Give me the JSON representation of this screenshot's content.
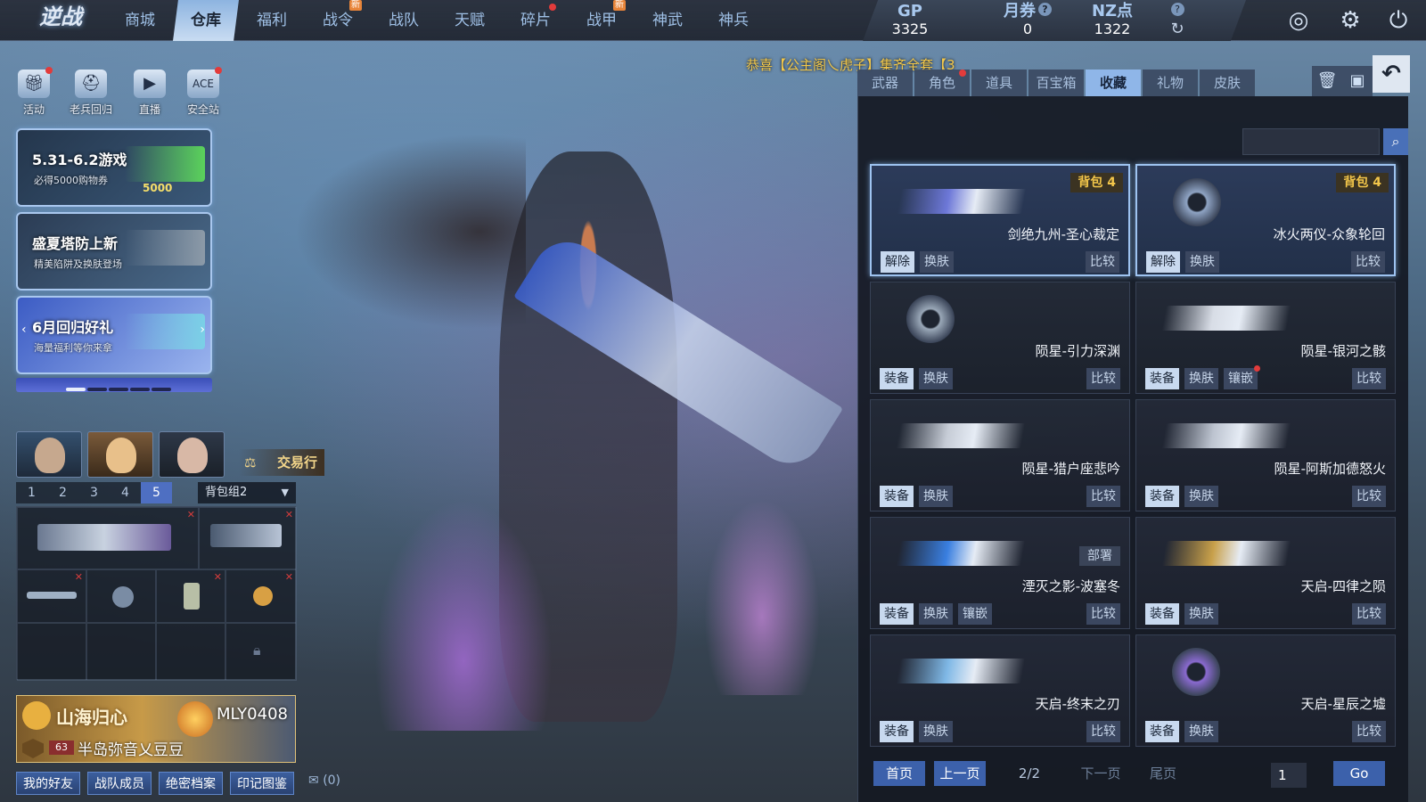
{
  "app": {
    "logo": "逆战"
  },
  "nav": [
    {
      "label": "商城",
      "badge": "",
      "dot": false,
      "active": false
    },
    {
      "label": "仓库",
      "badge": "",
      "dot": false,
      "active": true
    },
    {
      "label": "福利",
      "badge": "",
      "dot": false,
      "active": false
    },
    {
      "label": "战令",
      "badge": "新",
      "dot": false,
      "active": false
    },
    {
      "label": "战队",
      "badge": "",
      "dot": false,
      "active": false
    },
    {
      "label": "天赋",
      "badge": "",
      "dot": false,
      "active": false
    },
    {
      "label": "碎片",
      "badge": "",
      "dot": true,
      "active": false
    },
    {
      "label": "战甲",
      "badge": "新",
      "dot": false,
      "active": false
    },
    {
      "label": "神武",
      "badge": "",
      "dot": false,
      "active": false
    },
    {
      "label": "神兵",
      "badge": "",
      "dot": false,
      "active": false
    }
  ],
  "currency": {
    "gp": {
      "label": "GP",
      "value": "3325"
    },
    "voucher": {
      "label": "月券",
      "value": "0",
      "help": "?"
    },
    "nz": {
      "label": "NZ点",
      "value": "1322"
    },
    "help": "?"
  },
  "top_icons": [
    "refresh-icon",
    "radar-icon",
    "gear-icon",
    "power-icon"
  ],
  "announcement": "恭喜【公主阁乀虎子】集齐全套【3",
  "quick": [
    {
      "label": "活动",
      "icon": "gift-icon",
      "dot": true
    },
    {
      "label": "老兵回归",
      "icon": "helmet-icon",
      "dot": false
    },
    {
      "label": "直播",
      "icon": "tv-icon",
      "dot": false
    },
    {
      "label": "安全站",
      "icon": "ace-icon",
      "dot": true
    }
  ],
  "banners": [
    {
      "title": "5.31-6.2游戏",
      "subtitle": "必得5000购物券",
      "extra": "5000",
      "gun_color": "#5bd25b"
    },
    {
      "title": "盛夏塔防上新",
      "subtitle": "精美陷阱及换肤登场",
      "extra": "",
      "gun_color": "#8c9aa8"
    },
    {
      "title": "6月回归好礼",
      "subtitle": "海量福利等你来拿",
      "extra": "",
      "gun_color": "#7ad0e6"
    }
  ],
  "carousel": {
    "count": 5,
    "active": 0
  },
  "portraits": [
    "portrait-1",
    "portrait-2",
    "portrait-3"
  ],
  "trade_label": "交易行",
  "bag": {
    "tabs": [
      "1",
      "2",
      "3",
      "4",
      "5"
    ],
    "active_tab": 4,
    "group": "背包组2"
  },
  "profile": {
    "clan": "山海归心",
    "username": "MLY0408",
    "level": "63",
    "team": "半岛弥音乂豆豆"
  },
  "bottom_buttons": [
    "我的好友",
    "战队成员",
    "绝密档案",
    "印记图鉴"
  ],
  "mail": "(0)",
  "panel": {
    "tabs": [
      {
        "label": "武器",
        "dot": false
      },
      {
        "label": "角色",
        "dot": true
      },
      {
        "label": "道具",
        "dot": false
      },
      {
        "label": "百宝箱",
        "dot": false
      },
      {
        "label": "收藏",
        "dot": false
      },
      {
        "label": "礼物",
        "dot": false
      },
      {
        "label": "皮肤",
        "dot": false
      }
    ],
    "active_tab": 4,
    "search_placeholder": "",
    "items": [
      {
        "name": "剑绝九州-圣心裁定",
        "badge": "背包 4",
        "buttons": [
          "解除",
          "换肤"
        ],
        "compare": "比较",
        "selected": true,
        "color": "#6d78d8"
      },
      {
        "name": "冰火两仪-众象轮回",
        "badge": "背包 4",
        "buttons": [
          "解除",
          "换肤"
        ],
        "compare": "比较",
        "selected": true,
        "color": "#8fa4c4"
      },
      {
        "name": "陨星-引力深渊",
        "badge": "",
        "buttons": [
          "装备",
          "换肤"
        ],
        "compare": "比较",
        "selected": false,
        "color": "#9aa8b8"
      },
      {
        "name": "陨星-银河之骸",
        "badge": "",
        "buttons": [
          "装备",
          "换肤",
          "镶嵌"
        ],
        "compare": "比较",
        "selected": false,
        "color": "#d8dde6"
      },
      {
        "name": "陨星-猎户座悲吟",
        "badge": "",
        "buttons": [
          "装备",
          "换肤"
        ],
        "compare": "比较",
        "selected": false,
        "color": "#c6ccd6"
      },
      {
        "name": "陨星-阿斯加德怒火",
        "badge": "",
        "buttons": [
          "装备",
          "换肤"
        ],
        "compare": "比较",
        "selected": false,
        "color": "#bcc3cf"
      },
      {
        "name": "湮灭之影-波塞冬",
        "badge": "",
        "tag": "部署",
        "buttons": [
          "装备",
          "换肤",
          "镶嵌"
        ],
        "compare": "比较",
        "selected": false,
        "color": "#3a7fe0"
      },
      {
        "name": "天启-四律之陨",
        "badge": "",
        "buttons": [
          "装备",
          "换肤"
        ],
        "compare": "比较",
        "selected": false,
        "color": "#c8a04a"
      },
      {
        "name": "天启-终末之刃",
        "badge": "",
        "buttons": [
          "装备",
          "换肤"
        ],
        "compare": "比较",
        "selected": false,
        "color": "#7fb8e6"
      },
      {
        "name": "天启-星辰之墟",
        "badge": "",
        "buttons": [
          "装备",
          "换肤"
        ],
        "compare": "比较",
        "selected": false,
        "color": "#8a6ad0"
      }
    ],
    "pager": {
      "first": "首页",
      "prev": "上一页",
      "info": "2/2",
      "next": "下一页",
      "last": "尾页",
      "page_input": "1",
      "go": "Go"
    }
  }
}
